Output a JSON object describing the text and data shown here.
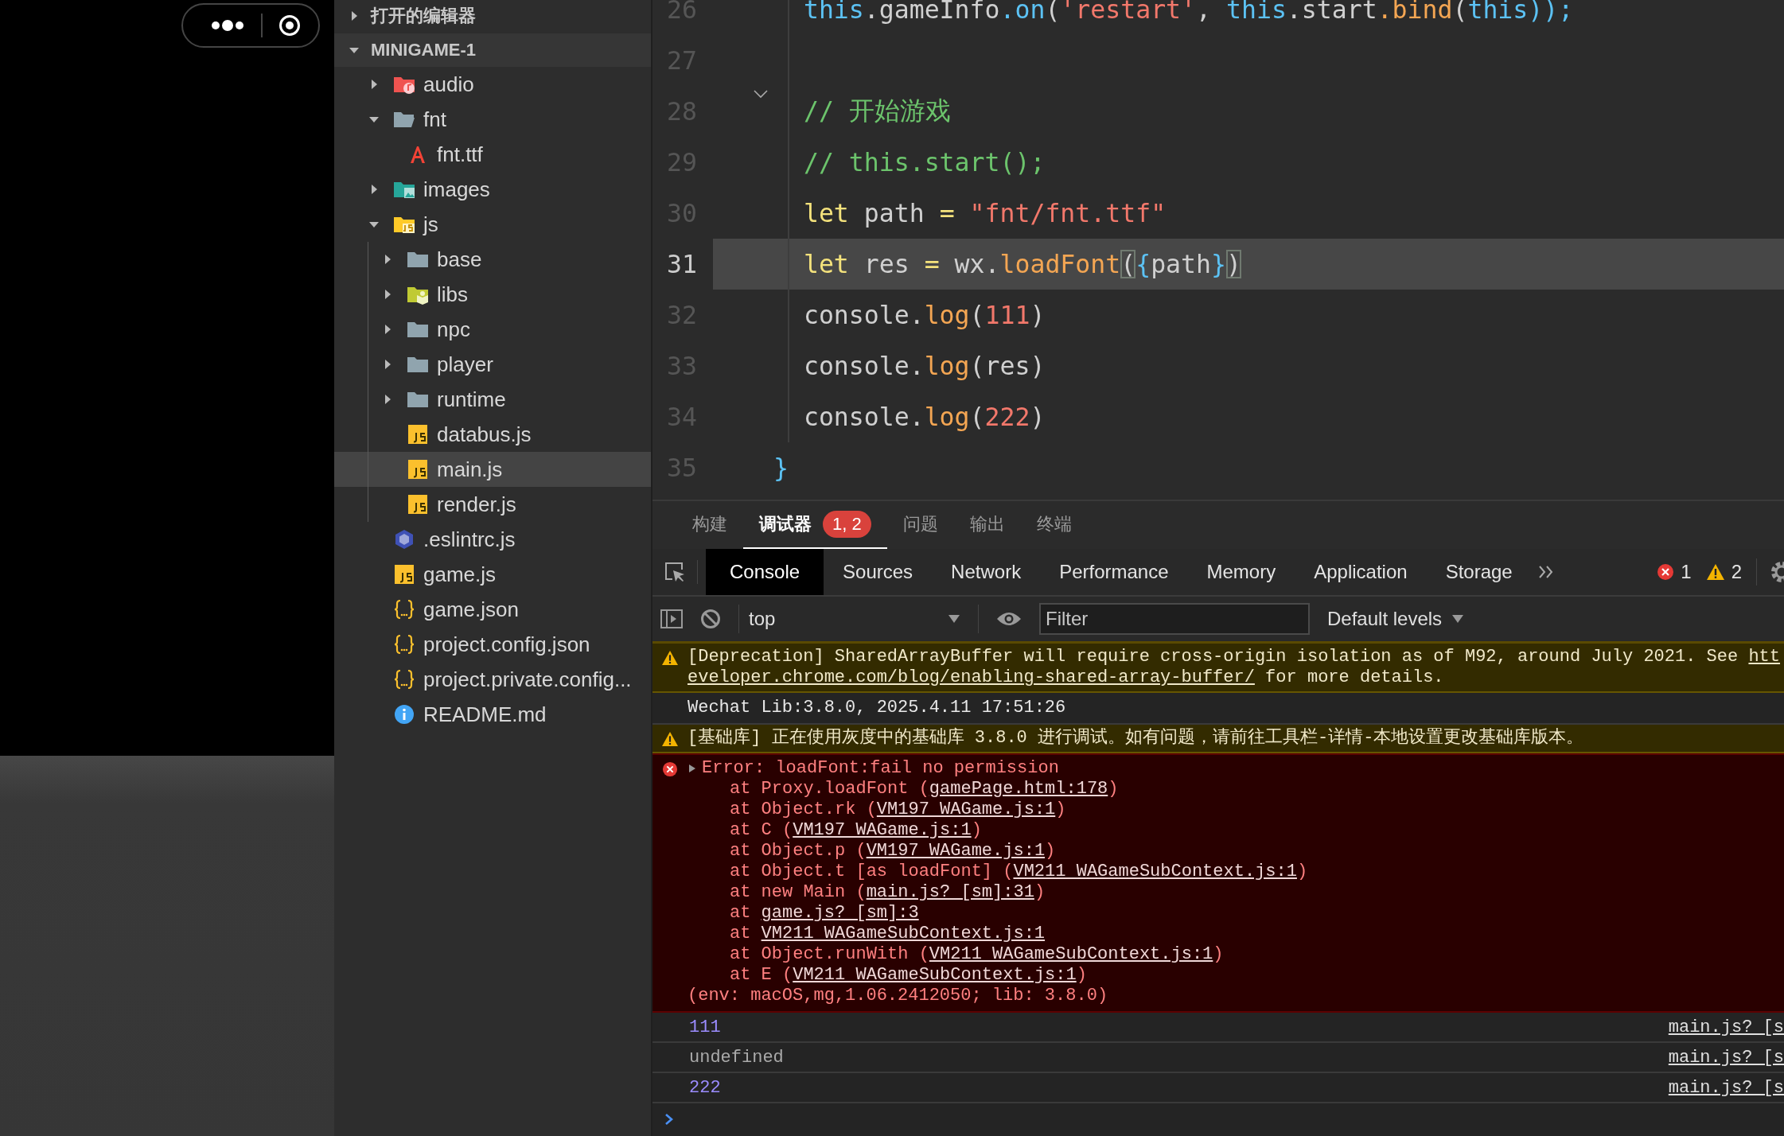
{
  "sidebar": {
    "sections": [
      {
        "title": "打开的编辑器",
        "expanded": false
      },
      {
        "title": "MINIGAME-1",
        "expanded": true,
        "items": [
          {
            "name": "audio",
            "kind": "audio_folder",
            "expanded": false,
            "selected": false
          },
          {
            "name": "fnt",
            "kind": "folder",
            "expanded": true,
            "selected": false,
            "children": [
              {
                "name": "fnt.ttf",
                "kind": "font_file",
                "selected": false
              }
            ]
          },
          {
            "name": "images",
            "kind": "image_folder",
            "expanded": false,
            "selected": false
          },
          {
            "name": "js",
            "kind": "js_folder",
            "expanded": true,
            "selected": false,
            "children": [
              {
                "name": "base",
                "kind": "folder",
                "expanded": false,
                "selected": false
              },
              {
                "name": "libs",
                "kind": "lib_folder",
                "expanded": false,
                "selected": false
              },
              {
                "name": "npc",
                "kind": "folder",
                "expanded": false,
                "selected": false
              },
              {
                "name": "player",
                "kind": "folder",
                "expanded": false,
                "selected": false
              },
              {
                "name": "runtime",
                "kind": "folder",
                "expanded": false,
                "selected": false
              },
              {
                "name": "databus.js",
                "kind": "js_file",
                "selected": false
              },
              {
                "name": "main.js",
                "kind": "js_file",
                "selected": true
              },
              {
                "name": "render.js",
                "kind": "js_file",
                "selected": false
              }
            ]
          },
          {
            "name": ".eslintrc.js",
            "kind": "eslint_file",
            "selected": false
          },
          {
            "name": "game.js",
            "kind": "js_file",
            "selected": false
          },
          {
            "name": "game.json",
            "kind": "json_file",
            "selected": false
          },
          {
            "name": "project.config.json",
            "kind": "json_file",
            "selected": false
          },
          {
            "name": "project.private.config...",
            "kind": "json_file",
            "selected": false
          },
          {
            "name": "README.md",
            "kind": "info_file",
            "selected": false
          }
        ]
      }
    ]
  },
  "editor": {
    "lines": [
      {
        "number": "26",
        "selected": false,
        "foldable": false,
        "tokens": [
          {
            "text": "  this",
            "kind": "this"
          },
          {
            "text": ".gameInfo",
            "kind": "plain"
          },
          {
            "text": ".on",
            "kind": "this"
          },
          {
            "text": "(",
            "kind": "plain"
          },
          {
            "text": "'restart'",
            "kind": "str"
          },
          {
            "text": ", ",
            "kind": "plain"
          },
          {
            "text": "this",
            "kind": "this"
          },
          {
            "text": ".start",
            "kind": "plain"
          },
          {
            "text": ".bind",
            "kind": "fn"
          },
          {
            "text": "(",
            "kind": "plain"
          },
          {
            "text": "this",
            "kind": "this"
          },
          {
            "text": "));",
            "kind": "this"
          }
        ]
      },
      {
        "number": "27",
        "selected": false,
        "foldable": false
      },
      {
        "number": "28",
        "selected": false,
        "foldable": true,
        "tokens": [
          {
            "text": "  // 开始游戏",
            "kind": "com"
          }
        ]
      },
      {
        "number": "29",
        "selected": false,
        "foldable": false,
        "tokens": [
          {
            "text": "  // this.start();",
            "kind": "com"
          }
        ]
      },
      {
        "number": "30",
        "selected": false,
        "foldable": false,
        "tokens": [
          {
            "text": "  let",
            "kind": "kw"
          },
          {
            "text": " path ",
            "kind": "plain"
          },
          {
            "text": "=",
            "kind": "kw"
          },
          {
            "text": " \"fnt/fnt.ttf\"",
            "kind": "str"
          }
        ]
      },
      {
        "number": "31",
        "selected": true,
        "foldable": false,
        "tokens": [
          {
            "text": "  let",
            "kind": "kw"
          },
          {
            "text": " res ",
            "kind": "plain"
          },
          {
            "text": "=",
            "kind": "kw"
          },
          {
            "text": " wx.",
            "kind": "plain"
          },
          {
            "text": "loadFont",
            "kind": "fn"
          },
          {
            "text": "(",
            "kind": "match"
          },
          {
            "text": "{",
            "kind": "this"
          },
          {
            "text": "path",
            "kind": "plain"
          },
          {
            "text": "}",
            "kind": "this"
          },
          {
            "text": ")",
            "kind": "match"
          }
        ]
      },
      {
        "number": "32",
        "selected": false,
        "foldable": false,
        "tokens": [
          {
            "text": "  console.",
            "kind": "plain"
          },
          {
            "text": "log",
            "kind": "fn"
          },
          {
            "text": "(",
            "kind": "plain"
          },
          {
            "text": "111",
            "kind": "num"
          },
          {
            "text": ")",
            "kind": "plain"
          }
        ]
      },
      {
        "number": "33",
        "selected": false,
        "foldable": false,
        "tokens": [
          {
            "text": "  console.",
            "kind": "plain"
          },
          {
            "text": "log",
            "kind": "fn"
          },
          {
            "text": "(res)",
            "kind": "plain"
          }
        ]
      },
      {
        "number": "34",
        "selected": false,
        "foldable": false,
        "tokens": [
          {
            "text": "  console.",
            "kind": "plain"
          },
          {
            "text": "log",
            "kind": "fn"
          },
          {
            "text": "(",
            "kind": "plain"
          },
          {
            "text": "222",
            "kind": "num"
          },
          {
            "text": ")",
            "kind": "plain"
          }
        ]
      },
      {
        "number": "35",
        "selected": false,
        "foldable": false,
        "tokens": [
          {
            "text": "}",
            "kind": "this"
          }
        ]
      }
    ]
  },
  "panel": {
    "tabs": [
      {
        "label": "构建",
        "selected": false
      },
      {
        "label": "调试器",
        "selected": true,
        "badge": "1, 2"
      },
      {
        "label": "问题",
        "selected": false
      },
      {
        "label": "输出",
        "selected": false
      },
      {
        "label": "终端",
        "selected": false
      }
    ]
  },
  "devtools": {
    "tabs": [
      {
        "label": "Console",
        "selected": true
      },
      {
        "label": "Sources",
        "selected": false
      },
      {
        "label": "Network",
        "selected": false
      },
      {
        "label": "Performance",
        "selected": false
      },
      {
        "label": "Memory",
        "selected": false
      },
      {
        "label": "Application",
        "selected": false
      },
      {
        "label": "Storage",
        "selected": false
      }
    ],
    "error_count": "1",
    "warning_count": "2",
    "context": "top",
    "filter": {
      "placeholder": "Filter"
    },
    "levels": "Default levels",
    "messages": [
      {
        "kind": "warning",
        "lines": [
          {
            "kind": "text",
            "segments": [
              {
                "text": "[Deprecation] SharedArrayBuffer will require cross-origin isolation as of M92, around July 2021. See "
              },
              {
                "text": "htt",
                "link": true
              }
            ]
          },
          {
            "kind": "text",
            "segments": [
              {
                "text": "eveloper.chrome.com/blog/enabling-shared-array-buffer/",
                "link": true
              },
              {
                "text": " for more details."
              }
            ]
          }
        ]
      },
      {
        "kind": "info",
        "lines": [
          {
            "kind": "text",
            "segments": [
              {
                "text": "Wechat Lib:3.8.0, 2025.4.11 17:51:26"
              }
            ]
          }
        ]
      },
      {
        "kind": "warning",
        "lines": [
          {
            "kind": "text",
            "segments": [
              {
                "text": "[基础库] 正在使用灰度中的基础库 3.8.0 进行调试。如有问题，请前往工具栏-详情-本地设置更改基础库版本。"
              }
            ]
          }
        ]
      },
      {
        "kind": "error",
        "lines": [
          {
            "kind": "head",
            "segments": [
              {
                "text": "Error: loadFont:fail no permission"
              }
            ]
          },
          {
            "kind": "stack",
            "segments": [
              {
                "text": "at Proxy.loadFont ("
              },
              {
                "text": "gamePage.html:178",
                "link": true
              },
              {
                "text": ")"
              }
            ]
          },
          {
            "kind": "stack",
            "segments": [
              {
                "text": "at Object.rk ("
              },
              {
                "text": "VM197 WAGame.js:1",
                "link": true
              },
              {
                "text": ")"
              }
            ]
          },
          {
            "kind": "stack",
            "segments": [
              {
                "text": "at C ("
              },
              {
                "text": "VM197 WAGame.js:1",
                "link": true
              },
              {
                "text": ")"
              }
            ]
          },
          {
            "kind": "stack",
            "segments": [
              {
                "text": "at Object.p ("
              },
              {
                "text": "VM197 WAGame.js:1",
                "link": true
              },
              {
                "text": ")"
              }
            ]
          },
          {
            "kind": "stack",
            "segments": [
              {
                "text": "at Object.t [as loadFont] ("
              },
              {
                "text": "VM211 WAGameSubContext.js:1",
                "link": true
              },
              {
                "text": ")"
              }
            ]
          },
          {
            "kind": "stack",
            "segments": [
              {
                "text": "at new Main ("
              },
              {
                "text": "main.js? [sm]:31",
                "link": true
              },
              {
                "text": ")"
              }
            ]
          },
          {
            "kind": "stack",
            "segments": [
              {
                "text": "at "
              },
              {
                "text": "game.js? [sm]:3",
                "link": true
              }
            ]
          },
          {
            "kind": "stack",
            "segments": [
              {
                "text": "at "
              },
              {
                "text": "VM211 WAGameSubContext.js:1",
                "link": true
              }
            ]
          },
          {
            "kind": "stack",
            "segments": [
              {
                "text": "at Object.runWith ("
              },
              {
                "text": "VM211 WAGameSubContext.js:1",
                "link": true
              },
              {
                "text": ")"
              }
            ]
          },
          {
            "kind": "stack",
            "segments": [
              {
                "text": "at E ("
              },
              {
                "text": "VM211 WAGameSubContext.js:1",
                "link": true
              },
              {
                "text": ")"
              }
            ]
          },
          {
            "kind": "env",
            "segments": [
              {
                "text": "(env: macOS,mg,1.06.2412050; lib: 3.8.0)"
              }
            ]
          }
        ]
      },
      {
        "kind": "log",
        "color": "#9b8cff",
        "value": "111",
        "source": "main.js? [s"
      },
      {
        "kind": "log",
        "color": "#aaaaaa",
        "value": "undefined",
        "source": "main.js? [s"
      },
      {
        "kind": "log",
        "color": "#9b8cff",
        "value": "222",
        "source": "main.js? [s"
      }
    ]
  }
}
